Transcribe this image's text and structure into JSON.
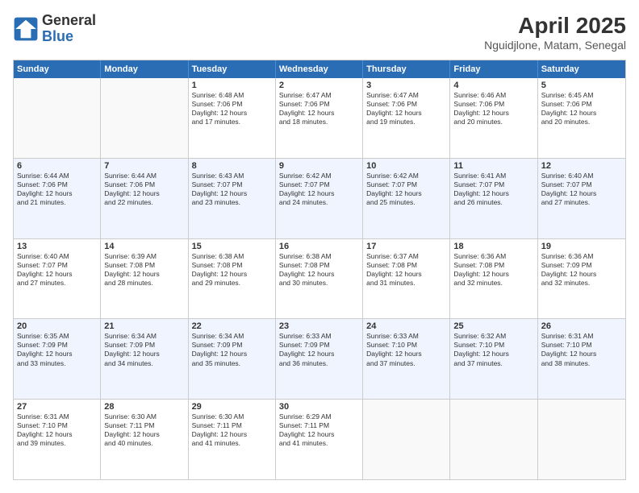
{
  "logo": {
    "general": "General",
    "blue": "Blue"
  },
  "title": "April 2025",
  "location": "Nguidjlone, Matam, Senegal",
  "days": [
    "Sunday",
    "Monday",
    "Tuesday",
    "Wednesday",
    "Thursday",
    "Friday",
    "Saturday"
  ],
  "weeks": [
    [
      {
        "day": "",
        "text": ""
      },
      {
        "day": "",
        "text": ""
      },
      {
        "day": "1",
        "text": "Sunrise: 6:48 AM\nSunset: 7:06 PM\nDaylight: 12 hours\nand 17 minutes."
      },
      {
        "day": "2",
        "text": "Sunrise: 6:47 AM\nSunset: 7:06 PM\nDaylight: 12 hours\nand 18 minutes."
      },
      {
        "day": "3",
        "text": "Sunrise: 6:47 AM\nSunset: 7:06 PM\nDaylight: 12 hours\nand 19 minutes."
      },
      {
        "day": "4",
        "text": "Sunrise: 6:46 AM\nSunset: 7:06 PM\nDaylight: 12 hours\nand 20 minutes."
      },
      {
        "day": "5",
        "text": "Sunrise: 6:45 AM\nSunset: 7:06 PM\nDaylight: 12 hours\nand 20 minutes."
      }
    ],
    [
      {
        "day": "6",
        "text": "Sunrise: 6:44 AM\nSunset: 7:06 PM\nDaylight: 12 hours\nand 21 minutes."
      },
      {
        "day": "7",
        "text": "Sunrise: 6:44 AM\nSunset: 7:06 PM\nDaylight: 12 hours\nand 22 minutes."
      },
      {
        "day": "8",
        "text": "Sunrise: 6:43 AM\nSunset: 7:07 PM\nDaylight: 12 hours\nand 23 minutes."
      },
      {
        "day": "9",
        "text": "Sunrise: 6:42 AM\nSunset: 7:07 PM\nDaylight: 12 hours\nand 24 minutes."
      },
      {
        "day": "10",
        "text": "Sunrise: 6:42 AM\nSunset: 7:07 PM\nDaylight: 12 hours\nand 25 minutes."
      },
      {
        "day": "11",
        "text": "Sunrise: 6:41 AM\nSunset: 7:07 PM\nDaylight: 12 hours\nand 26 minutes."
      },
      {
        "day": "12",
        "text": "Sunrise: 6:40 AM\nSunset: 7:07 PM\nDaylight: 12 hours\nand 27 minutes."
      }
    ],
    [
      {
        "day": "13",
        "text": "Sunrise: 6:40 AM\nSunset: 7:07 PM\nDaylight: 12 hours\nand 27 minutes."
      },
      {
        "day": "14",
        "text": "Sunrise: 6:39 AM\nSunset: 7:08 PM\nDaylight: 12 hours\nand 28 minutes."
      },
      {
        "day": "15",
        "text": "Sunrise: 6:38 AM\nSunset: 7:08 PM\nDaylight: 12 hours\nand 29 minutes."
      },
      {
        "day": "16",
        "text": "Sunrise: 6:38 AM\nSunset: 7:08 PM\nDaylight: 12 hours\nand 30 minutes."
      },
      {
        "day": "17",
        "text": "Sunrise: 6:37 AM\nSunset: 7:08 PM\nDaylight: 12 hours\nand 31 minutes."
      },
      {
        "day": "18",
        "text": "Sunrise: 6:36 AM\nSunset: 7:08 PM\nDaylight: 12 hours\nand 32 minutes."
      },
      {
        "day": "19",
        "text": "Sunrise: 6:36 AM\nSunset: 7:09 PM\nDaylight: 12 hours\nand 32 minutes."
      }
    ],
    [
      {
        "day": "20",
        "text": "Sunrise: 6:35 AM\nSunset: 7:09 PM\nDaylight: 12 hours\nand 33 minutes."
      },
      {
        "day": "21",
        "text": "Sunrise: 6:34 AM\nSunset: 7:09 PM\nDaylight: 12 hours\nand 34 minutes."
      },
      {
        "day": "22",
        "text": "Sunrise: 6:34 AM\nSunset: 7:09 PM\nDaylight: 12 hours\nand 35 minutes."
      },
      {
        "day": "23",
        "text": "Sunrise: 6:33 AM\nSunset: 7:09 PM\nDaylight: 12 hours\nand 36 minutes."
      },
      {
        "day": "24",
        "text": "Sunrise: 6:33 AM\nSunset: 7:10 PM\nDaylight: 12 hours\nand 37 minutes."
      },
      {
        "day": "25",
        "text": "Sunrise: 6:32 AM\nSunset: 7:10 PM\nDaylight: 12 hours\nand 37 minutes."
      },
      {
        "day": "26",
        "text": "Sunrise: 6:31 AM\nSunset: 7:10 PM\nDaylight: 12 hours\nand 38 minutes."
      }
    ],
    [
      {
        "day": "27",
        "text": "Sunrise: 6:31 AM\nSunset: 7:10 PM\nDaylight: 12 hours\nand 39 minutes."
      },
      {
        "day": "28",
        "text": "Sunrise: 6:30 AM\nSunset: 7:11 PM\nDaylight: 12 hours\nand 40 minutes."
      },
      {
        "day": "29",
        "text": "Sunrise: 6:30 AM\nSunset: 7:11 PM\nDaylight: 12 hours\nand 41 minutes."
      },
      {
        "day": "30",
        "text": "Sunrise: 6:29 AM\nSunset: 7:11 PM\nDaylight: 12 hours\nand 41 minutes."
      },
      {
        "day": "",
        "text": ""
      },
      {
        "day": "",
        "text": ""
      },
      {
        "day": "",
        "text": ""
      }
    ]
  ]
}
